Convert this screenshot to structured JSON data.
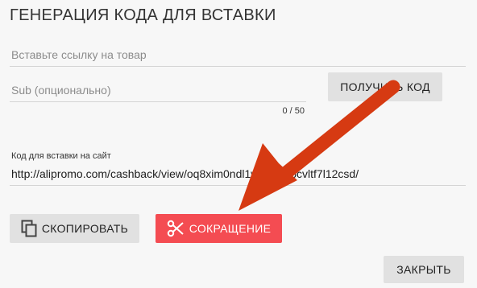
{
  "dialog": {
    "title": "ГЕНЕРАЦИЯ КОДА ДЛЯ ВСТАВКИ",
    "url_field": {
      "placeholder": "Вставьте ссылку на товар",
      "value": ""
    },
    "sub_field": {
      "placeholder": "Sub (опционально)",
      "value": "",
      "counter": "0 / 50"
    },
    "get_code_button": {
      "label": "ПОЛУЧИТЬ КОД"
    },
    "code_field": {
      "label": "Код для вставки на сайт",
      "value": "http://alipromo.com/cashback/view/oq8xim0ndl1wr4vm9bcvltf7l12csd/"
    },
    "copy_button": {
      "label": "СКОПИРОВАТЬ",
      "icon": "copy-icon"
    },
    "shorten_button": {
      "label": "СОКРАЩЕНИЕ",
      "icon": "scissors-icon"
    },
    "close_button": {
      "label": "ЗАКРЫТЬ"
    }
  },
  "colors": {
    "accent_red": "#f44c52",
    "annotation_arrow": "#d63a12",
    "button_gray": "#e1e1e1",
    "background": "#f7f7f7"
  }
}
